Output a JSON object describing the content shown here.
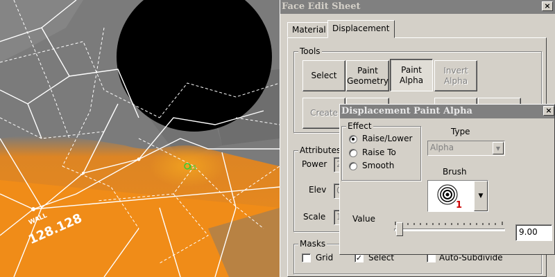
{
  "viewport": {
    "wall_label": "WALL",
    "wall_value": "128.128",
    "vertex_marker": "15"
  },
  "face_edit_sheet": {
    "title": "Face Edit Sheet",
    "close_glyph": "×",
    "tabs": [
      {
        "label": "Material",
        "selected": false
      },
      {
        "label": "Displacement",
        "selected": true
      }
    ],
    "tools": {
      "group_label": "Tools",
      "buttons": [
        {
          "label": "Select",
          "state": "normal"
        },
        {
          "label": "Paint Geometry",
          "state": "normal"
        },
        {
          "label": "Paint Alpha",
          "state": "pressed"
        },
        {
          "label": "Invert Alpha",
          "state": "disabled"
        }
      ],
      "create_label": "Create"
    },
    "attributes": {
      "group_label": "Attributes",
      "power_label": "Power",
      "power_value": "2",
      "elev_label": "Elev",
      "elev_value": "0",
      "scale_label": "Scale",
      "scale_value": "1"
    },
    "masks": {
      "group_label": "Masks",
      "grid_label": "Grid",
      "grid_checked": false,
      "select_label": "Select",
      "select_checked": true,
      "auto_subdivide_label": "Auto-Subdivide",
      "auto_subdivide_checked": false
    }
  },
  "paint_alpha_dialog": {
    "title": "Displacement Paint Alpha",
    "close_glyph": "×",
    "effect": {
      "group_label": "Effect",
      "options": [
        {
          "label": "Raise/Lower",
          "selected": true
        },
        {
          "label": "Raise To",
          "selected": false
        },
        {
          "label": "Smooth",
          "selected": false
        }
      ]
    },
    "type_label": "Type",
    "type_value": "Alpha",
    "brush_label": "Brush",
    "brush_number": "1",
    "value_label": "Value",
    "value": "9.00",
    "slider_fraction": 0.02
  },
  "colors": {
    "viewport_gray": "#7a7a7a",
    "orange": "#e8861a",
    "title_gray": "#808080",
    "dialog_face": "#d4d0c8",
    "brush_number_red": "#cc0000"
  }
}
